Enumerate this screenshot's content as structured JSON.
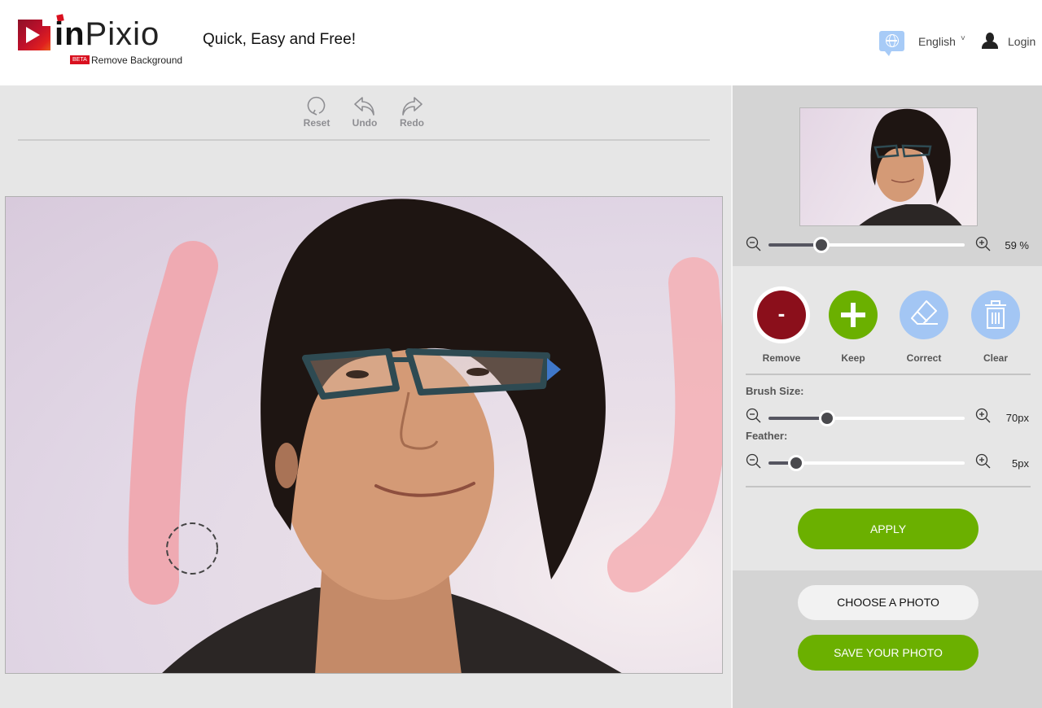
{
  "header": {
    "brand_bold": "in",
    "brand_light": "Pixio",
    "beta_badge": "BETA",
    "brand_subtitle": "Remove Background",
    "tagline": "Quick, Easy and Free!",
    "language": "English",
    "language_chevron": "˅",
    "login": "Login"
  },
  "toolbar": {
    "reset": "Reset",
    "undo": "Undo",
    "redo": "Redo"
  },
  "canvas": {
    "subject": "Portrait of a man with black hair and patterned glasses",
    "stroke_mode": "Remove",
    "stroke_color": "#f0a6ae"
  },
  "preview": {
    "zoom_value": "59 %",
    "zoom_percent": 59
  },
  "tools": {
    "remove": "Remove",
    "remove_glyph": "-",
    "keep": "Keep",
    "correct": "Correct",
    "clear": "Clear",
    "active": "remove"
  },
  "brush": {
    "size_label": "Brush Size:",
    "size_value": "70px",
    "size_fraction": 0.3,
    "feather_label": "Feather:",
    "feather_value": "5px",
    "feather_fraction": 0.14
  },
  "actions": {
    "apply": "APPLY",
    "choose": "CHOOSE A PHOTO",
    "save": "SAVE YOUR PHOTO"
  },
  "colors": {
    "brand_red": "#d9101f",
    "remove": "#8b0f1b",
    "keep": "#6bb000",
    "correct": "#a3c6f4",
    "button_green": "#6bb000"
  }
}
